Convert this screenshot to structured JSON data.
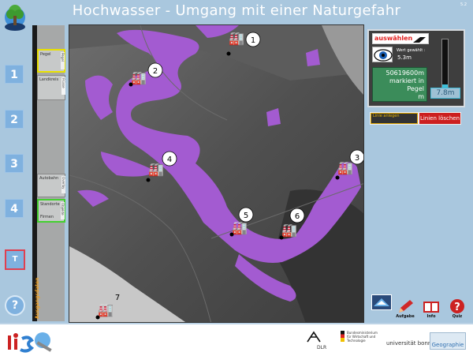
{
  "app": {
    "title": "Hochwasser - Umgang mit einer Naturgefahr",
    "version": "5.2"
  },
  "nav": {
    "steps": [
      "1",
      "2",
      "3",
      "4"
    ],
    "t_label": "T",
    "help_label": "?"
  },
  "layers": {
    "pegel": "Pegel",
    "landkreis": "Landkreis",
    "autobahn": "Autobahn",
    "standorte": "Standorte",
    "firmen": "Firmen",
    "vertical_1": "Pegel",
    "vertical_2": "Flüsse",
    "vertical_3": "Overlay",
    "vertical_4": "Objekte",
    "strip_title": "Ausgangsdaten"
  },
  "map": {
    "markers": [
      "1",
      "2",
      "3",
      "4",
      "5",
      "6",
      "7"
    ]
  },
  "panel": {
    "select_label": "auswählen",
    "wert_label": "Wert gewählt :",
    "wert_value": "5.3m",
    "marked_count": "50619600m",
    "marked_text": "markiert in",
    "marked_pegel": "Pegel",
    "marked_unit": "m",
    "level_value": "7.8m",
    "gauge_fill_percent": 8
  },
  "line_tools": {
    "add_line": "Linie anlegen",
    "clear_lines": "Linien löschen"
  },
  "tools": {
    "task": "Aufgabe",
    "info": "Info",
    "quiz": "Quiz"
  },
  "footer": {
    "dlr": "DLR",
    "ministry": "Bundesministerium für Wirtschaft und Technologie",
    "university": "universität bonn",
    "geography": "Geographie"
  },
  "colors": {
    "background": "#a9c7de",
    "flood": "#a35bd1",
    "accent_red": "#cc1f1f"
  }
}
